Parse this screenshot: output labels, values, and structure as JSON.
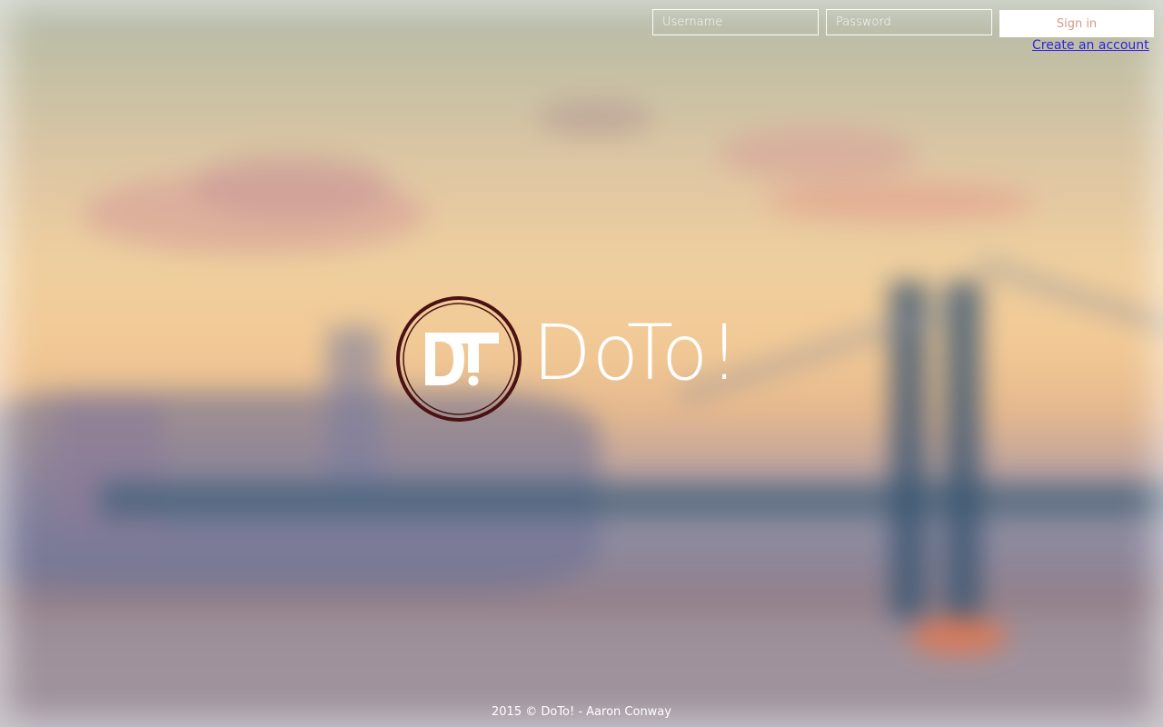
{
  "header": {
    "username_placeholder": "Username",
    "password_placeholder": "Password",
    "signin_label": "Sign in",
    "create_account_label": "Create an account"
  },
  "logo": {
    "monogram": "DT",
    "title": "DoTo!"
  },
  "footer": {
    "text": "2015 © DoTo! - Aaron Conway"
  },
  "colors": {
    "signin_text": "#d69a85",
    "link": "#2d23e0",
    "logo_ring": "#4a1212"
  },
  "background": {
    "icon": "blurred-city-bridge-photo"
  }
}
